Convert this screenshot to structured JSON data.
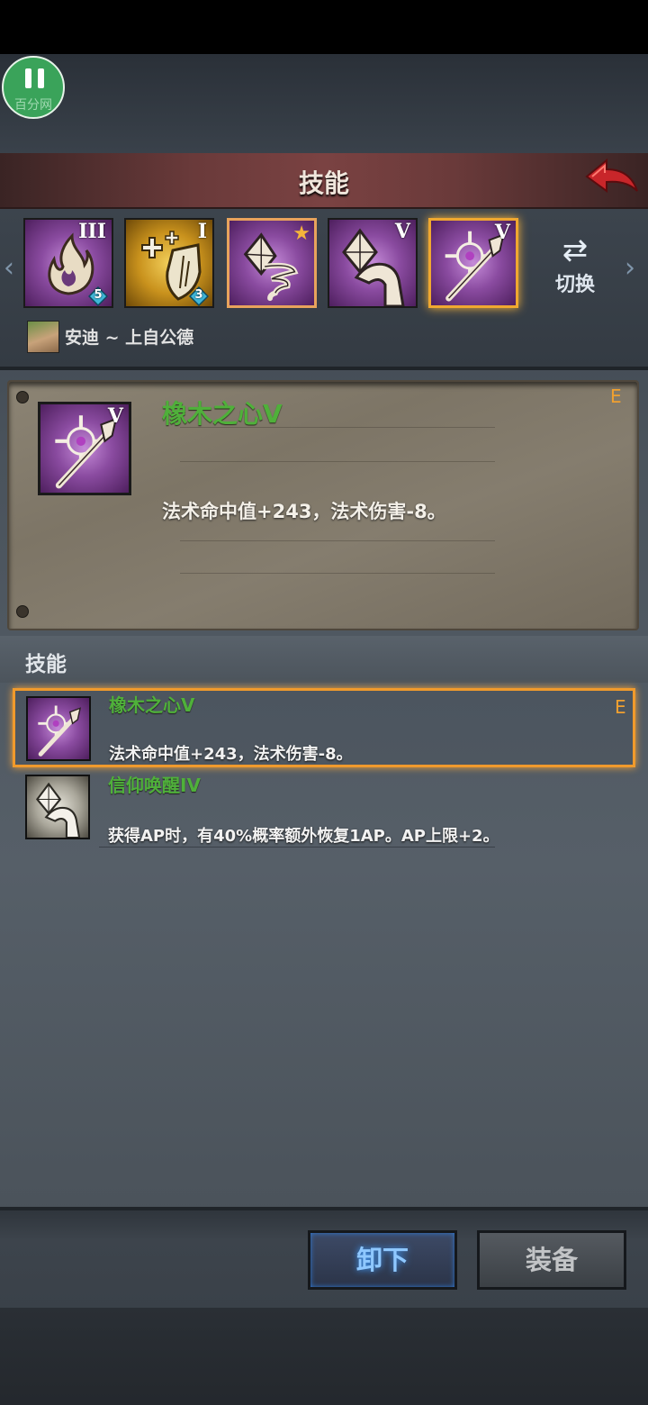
{
  "watermark": "百分网",
  "header": {
    "title": "技能"
  },
  "skill_slots": [
    {
      "icon": "flame-icon",
      "level": "III",
      "badge": "5"
    },
    {
      "icon": "cross-shield-icon",
      "level": "I",
      "badge": "3"
    },
    {
      "icon": "crystal-tornado-icon",
      "level": ""
    },
    {
      "icon": "crystal-hand-icon",
      "level": "V"
    },
    {
      "icon": "oak-heart-staff-icon",
      "level": "V"
    }
  ],
  "switch_label": "切换",
  "character": {
    "name": "安迪 ~ 上自公德"
  },
  "detail": {
    "name": "橡木之心V",
    "description": "法术命中值+243，法术伤害-8。",
    "tag": "E",
    "level": "V"
  },
  "section": {
    "title": "技能"
  },
  "skills_list": [
    {
      "name": "橡木之心V",
      "description": "法术命中值+243，法术伤害-8。",
      "tag": "E"
    },
    {
      "name": "信仰唤醒IV",
      "description": "获得AP时，有40%概率额外恢复1AP。AP上限+2。"
    }
  ],
  "buttons": {
    "unequip": "卸下",
    "equip": "装备"
  },
  "colors": {
    "skill_name": "#4fb03a",
    "tag": "#f0a030",
    "selection": "#f09a2c"
  }
}
